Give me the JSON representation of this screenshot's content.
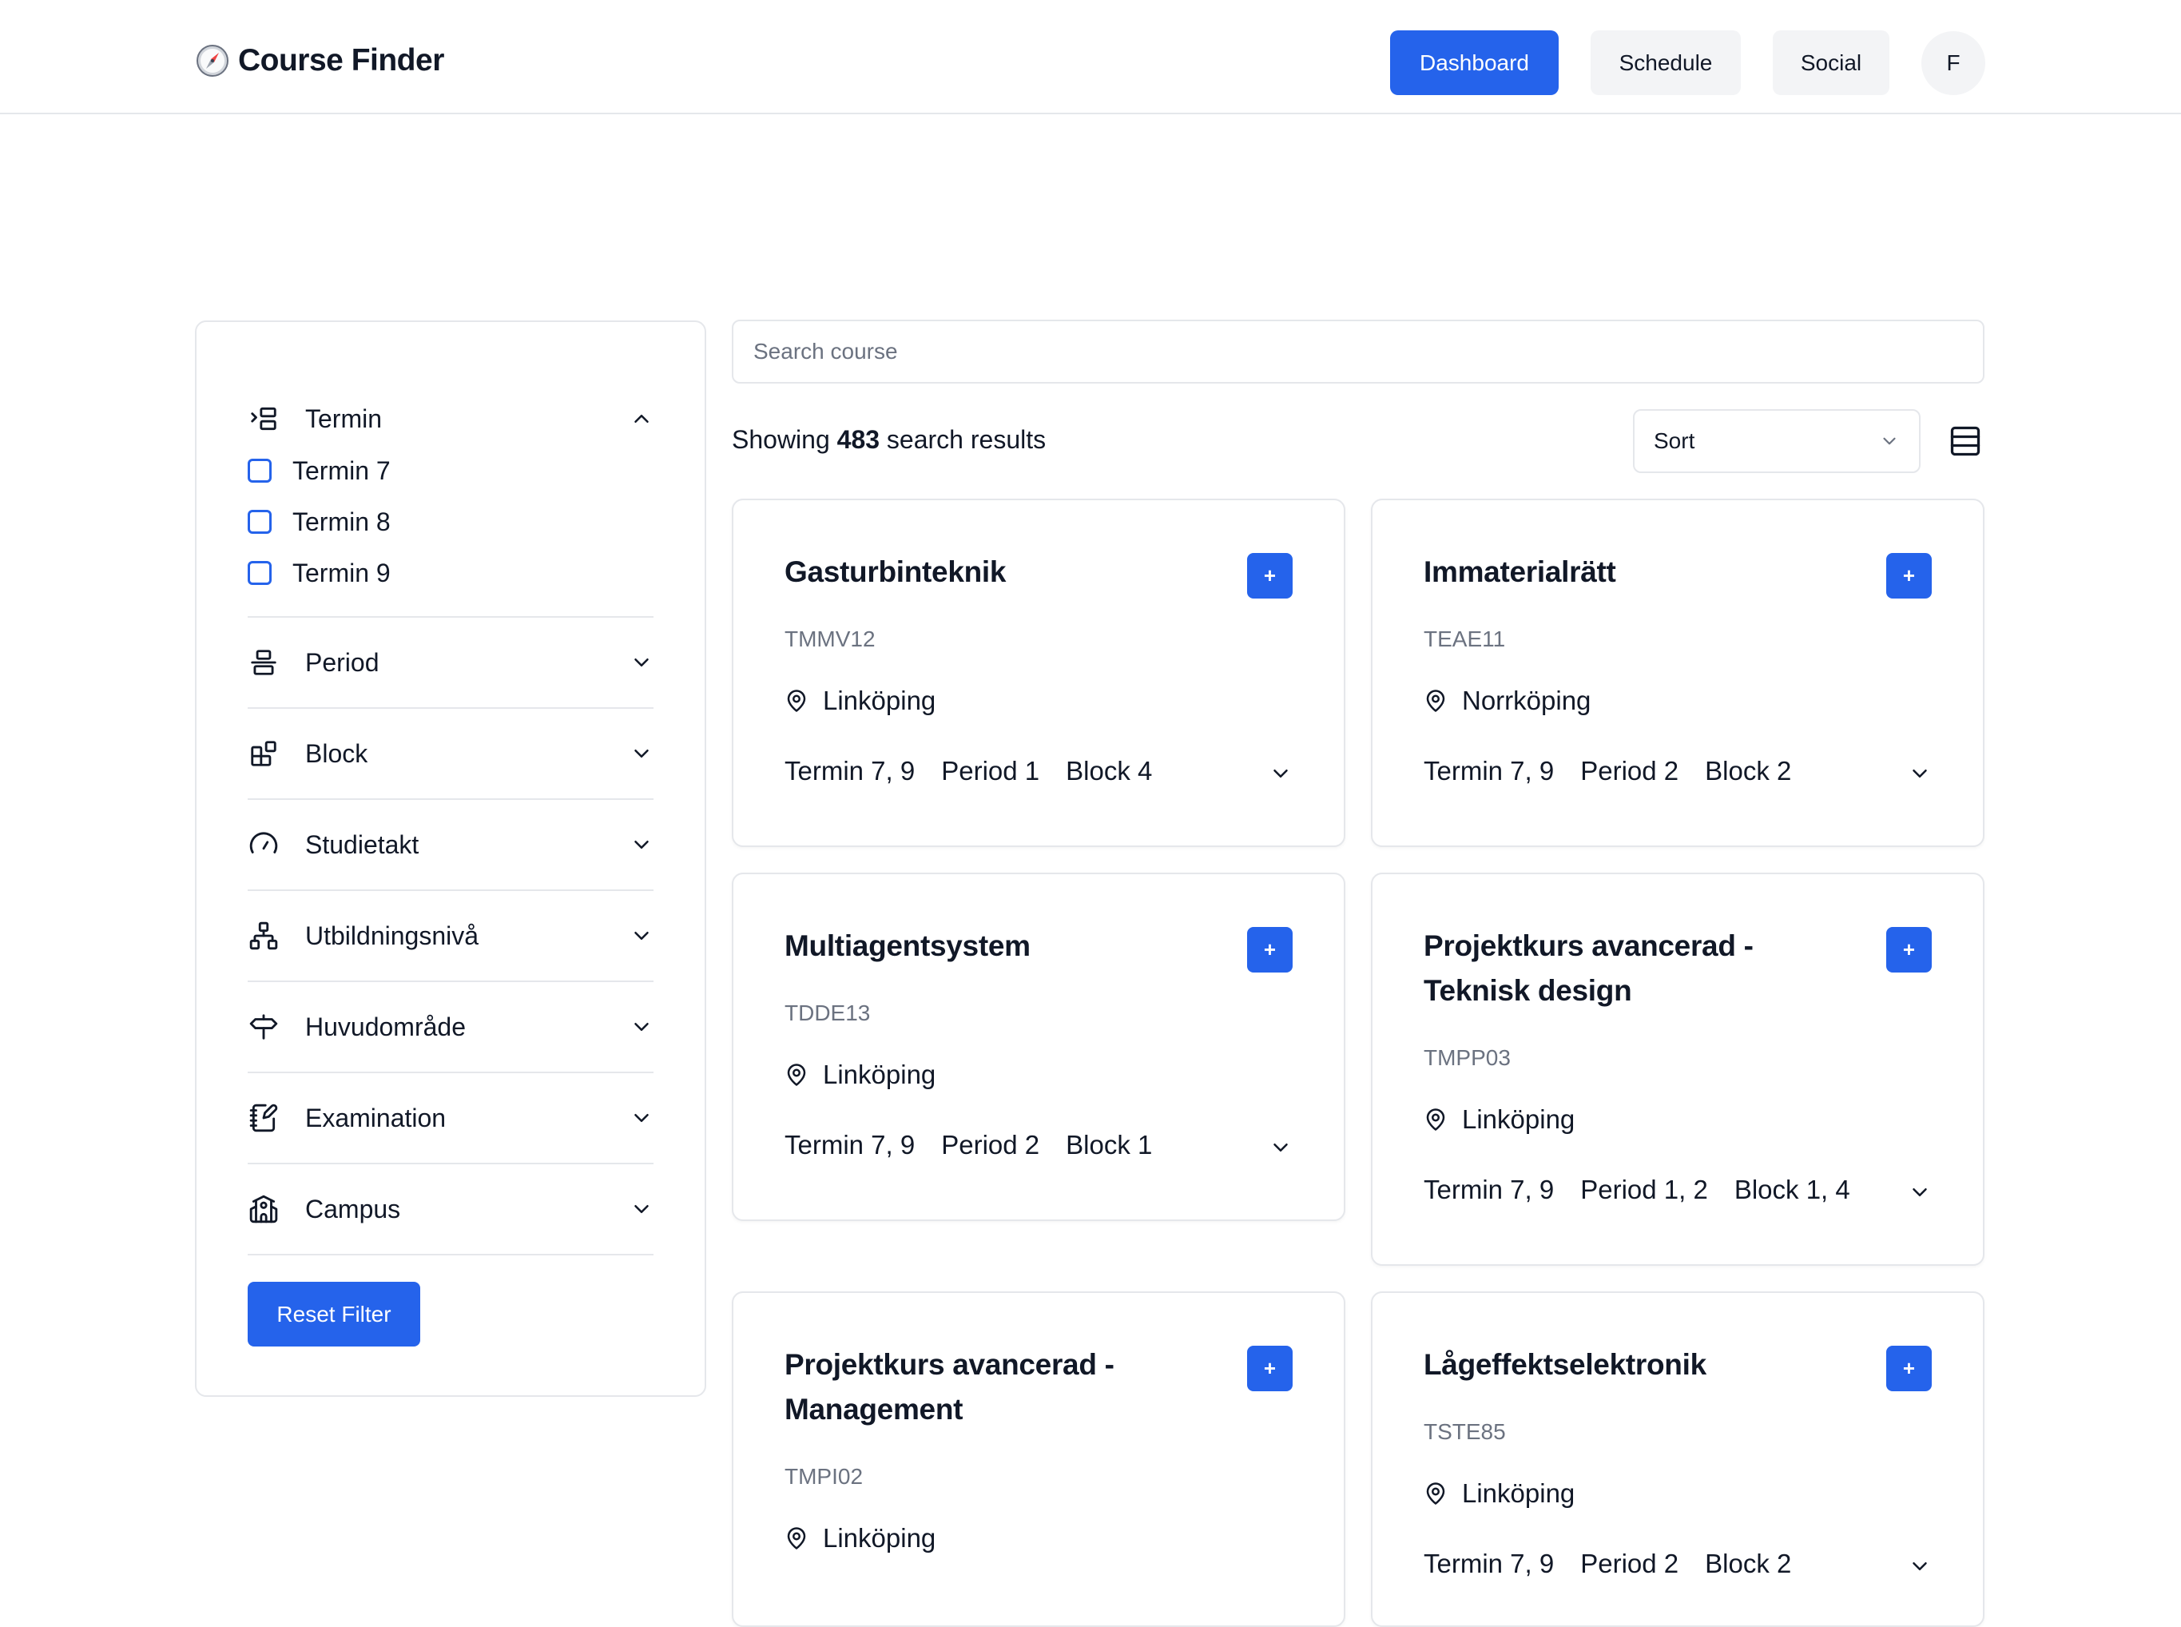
{
  "header": {
    "brand_icon": "compass-icon",
    "title": "Course Finder",
    "nav": {
      "dashboard": "Dashboard",
      "schedule": "Schedule",
      "social": "Social"
    },
    "avatar": "F",
    "accent": "#2563eb"
  },
  "sidebar": {
    "termin": {
      "title": "Termin",
      "icon": "indent-list-icon",
      "expanded": true,
      "options": [
        "Termin 7",
        "Termin 8",
        "Termin 9"
      ]
    },
    "filters": [
      {
        "title": "Period",
        "icon": "align-center-icon"
      },
      {
        "title": "Block",
        "icon": "blocks-icon"
      },
      {
        "title": "Studietakt",
        "icon": "gauge-icon"
      },
      {
        "title": "Utbildningsnivå",
        "icon": "network-icon"
      },
      {
        "title": "Huvudområde",
        "icon": "signpost-icon"
      },
      {
        "title": "Examination",
        "icon": "notebook-pen-icon"
      },
      {
        "title": "Campus",
        "icon": "school-icon"
      }
    ],
    "reset_label": "Reset Filter"
  },
  "main": {
    "search_placeholder": "Search course",
    "results_prefix": "Showing",
    "results_count": "483",
    "results_suffix": "search results",
    "sort_label": "Sort",
    "cards": [
      {
        "title": "Gasturbinteknik",
        "code": "TMMV12",
        "location": "Linköping",
        "termin": "Termin 7, 9",
        "period": "Period 1",
        "block": "Block 4"
      },
      {
        "title": "Immaterialrätt",
        "code": "TEAE11",
        "location": "Norrköping",
        "termin": "Termin 7, 9",
        "period": "Period 2",
        "block": "Block 2"
      },
      {
        "title": "Multiagentsystem",
        "code": "TDDE13",
        "location": "Linköping",
        "termin": "Termin 7, 9",
        "period": "Period 2",
        "block": "Block 1"
      },
      {
        "title": "Projektkurs avancerad - Teknisk design",
        "code": "TMPP03",
        "location": "Linköping",
        "termin": "Termin 7, 9",
        "period": "Period 1, 2",
        "block": "Block 1, 4"
      },
      {
        "title": "Projektkurs avancerad - Management",
        "code": "TMPI02",
        "location": "Linköping",
        "termin": "",
        "period": "",
        "block": ""
      },
      {
        "title": "Lågeffektselektronik",
        "code": "TSTE85",
        "location": "Linköping",
        "termin": "Termin 7, 9",
        "period": "Period 2",
        "block": "Block 2"
      }
    ],
    "add_label": "+"
  }
}
